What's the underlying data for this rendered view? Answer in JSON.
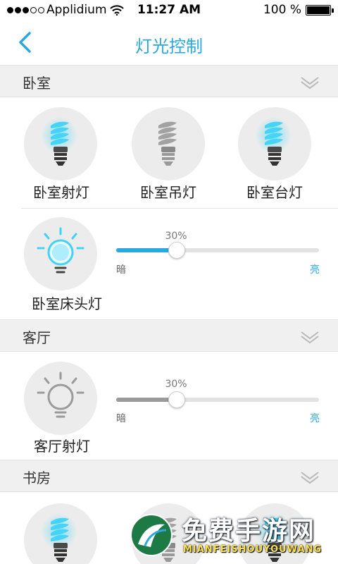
{
  "status_bar": {
    "carrier": "Applidium",
    "time": "11:27 AM",
    "battery": "100 %"
  },
  "nav": {
    "title": "灯光控制"
  },
  "colors": {
    "accent": "#2aa9e0",
    "glow": "#3fd3f5",
    "off_gray": "#9a9a9a",
    "section_bg": "#f0f0f0"
  },
  "sections": [
    {
      "title": "卧室",
      "bulbs": [
        {
          "label": "卧室射灯",
          "icon": "cfl-bulb-on-icon",
          "state": "on"
        },
        {
          "label": "卧室吊灯",
          "icon": "cfl-bulb-off-icon",
          "state": "off"
        },
        {
          "label": "卧室台灯",
          "icon": "cfl-bulb-on-icon",
          "state": "on"
        }
      ],
      "dimmer": {
        "label": "卧室床头灯",
        "icon": "round-bulb-on-icon",
        "percent_text": "30%",
        "value": 0.3,
        "dim": "暗",
        "bright": "亮"
      }
    },
    {
      "title": "客厅",
      "dimmer": {
        "label": "客厅射灯",
        "icon": "round-bulb-off-icon",
        "percent_text": "30%",
        "value": 0.3,
        "dim": "暗",
        "bright": "亮"
      }
    },
    {
      "title": "书房",
      "bulbs": [
        {
          "icon": "cfl-bulb-on-icon",
          "state": "on"
        },
        {
          "icon": "cfl-bulb-off-icon",
          "state": "off"
        },
        {
          "icon": "cfl-bulb-on-icon",
          "state": "on"
        }
      ]
    }
  ],
  "watermark": {
    "title": "免费手游网",
    "subtitle": "MIANFEISHOUYOUWANG"
  }
}
